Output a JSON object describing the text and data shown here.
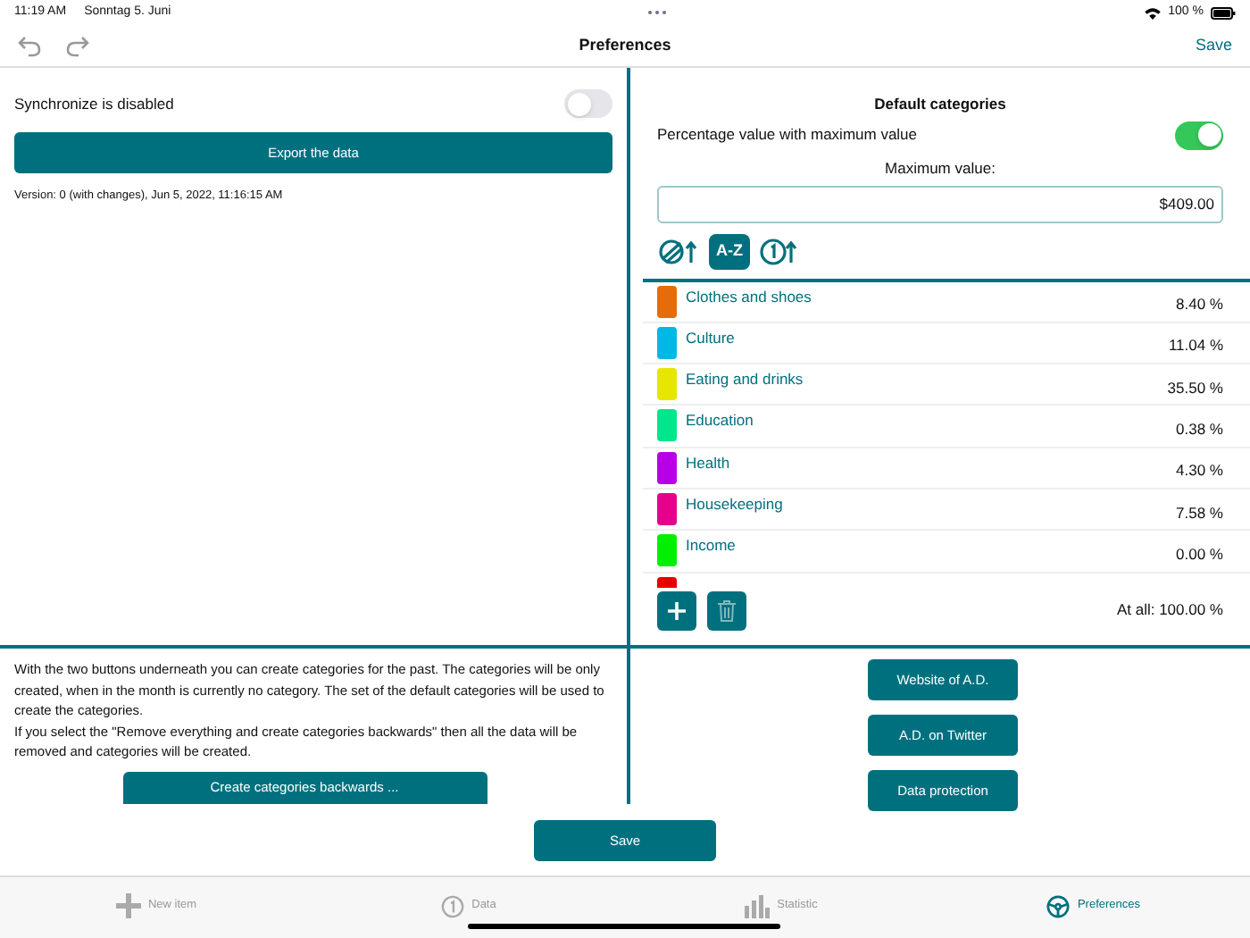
{
  "status_bar": {
    "time": "11:19 AM",
    "date": "Sonntag 5. Juni",
    "battery": "100 %"
  },
  "nav": {
    "title": "Preferences",
    "save": "Save"
  },
  "sync": {
    "label": "Synchronize is disabled",
    "on": false
  },
  "export_button": "Export the data",
  "version": "Version: 0 (with changes), Jun 5, 2022, 11:16:15 AM",
  "default_categories": {
    "title": "Default categories",
    "percentage_label": "Percentage value with maximum value",
    "percentage_on": true,
    "maximum_label": "Maximum value:",
    "maximum_value": "$409.00",
    "sort_buttons": [
      {
        "kind": "color",
        "selected": false
      },
      {
        "kind": "alpha",
        "label": "A-Z",
        "selected": true
      },
      {
        "kind": "number",
        "selected": false
      }
    ],
    "items": [
      {
        "name": "Clothes and shoes",
        "value": "8.40 %",
        "color": "#e46c0a"
      },
      {
        "name": "Culture",
        "value": "11.04 %",
        "color": "#00b8e6"
      },
      {
        "name": "Eating and drinks",
        "value": "35.50 %",
        "color": "#e6e600"
      },
      {
        "name": "Education",
        "value": "0.38 %",
        "color": "#00e68c"
      },
      {
        "name": "Health",
        "value": "4.30 %",
        "color": "#b800e6"
      },
      {
        "name": "Housekeeping",
        "value": "7.58 %",
        "color": "#e6008c"
      },
      {
        "name": "Income",
        "value": "0.00 %",
        "color": "#00f000"
      },
      {
        "color": "#e60000"
      }
    ],
    "total": "At all: 100.00 %"
  },
  "backwards": {
    "text": "With the two buttons underneath you can create categories for the past. The categories will be only created, when in the month is currently no category. The set of the default categories will be used to create the categories.\n If you select the \"Remove everything and create categories backwards\" then all the data will be removed and categories will be created.",
    "button": "Create categories backwards ..."
  },
  "links": [
    "Website of A.D.",
    "A.D. on Twitter",
    "Data protection"
  ],
  "save_button": "Save",
  "tabs": [
    {
      "kind": "plus",
      "label": "New item",
      "selected": false
    },
    {
      "kind": "data",
      "label": "Data",
      "selected": false
    },
    {
      "kind": "chart",
      "label": "Statistic",
      "selected": false
    },
    {
      "kind": "wheel",
      "label": "Preferences",
      "selected": true
    }
  ]
}
